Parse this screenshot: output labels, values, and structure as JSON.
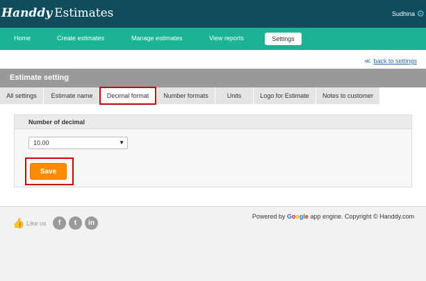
{
  "header": {
    "logo_script": "Handdy",
    "logo_rest": "Estimates",
    "user_name": "Sudhina",
    "gear_icon": "gear-icon"
  },
  "nav": {
    "items": [
      {
        "label": "Home"
      },
      {
        "label": "Create estimates"
      },
      {
        "label": "Manage estimates"
      },
      {
        "label": "View reports"
      }
    ],
    "active": {
      "label": "Settings"
    }
  },
  "breadcrumb": {
    "arrows": "≪",
    "back_label": "back to settings"
  },
  "section": {
    "title": "Estimate setting"
  },
  "tabs": [
    {
      "label": "All settings"
    },
    {
      "label": "Estimate name"
    },
    {
      "label": "Decimal format"
    },
    {
      "label": "Number formats"
    },
    {
      "label": "Units"
    },
    {
      "label": "Logo for Estimate"
    },
    {
      "label": "Notes to customer"
    }
  ],
  "active_tab_index": 2,
  "panel": {
    "title": "Number of decimal",
    "select_value": "10.00",
    "save_label": "Save"
  },
  "footer": {
    "like_us": "Like us",
    "social": [
      {
        "icon": "facebook-icon",
        "glyph": "f"
      },
      {
        "icon": "twitter-icon",
        "glyph": "t"
      },
      {
        "icon": "linkedin-icon",
        "glyph": "in"
      }
    ],
    "powered_prefix": "Powered by",
    "google_letters": [
      "G",
      "o",
      "o",
      "g",
      "l",
      "e"
    ],
    "powered_suffix": "app engine. Copyright © Handdy.com"
  },
  "colors": {
    "topbar": "#0f4c5c",
    "navbar": "#1ab394",
    "save_button": "#ff8c00",
    "highlight_box": "#cc0000",
    "link": "#2a6fb5"
  }
}
